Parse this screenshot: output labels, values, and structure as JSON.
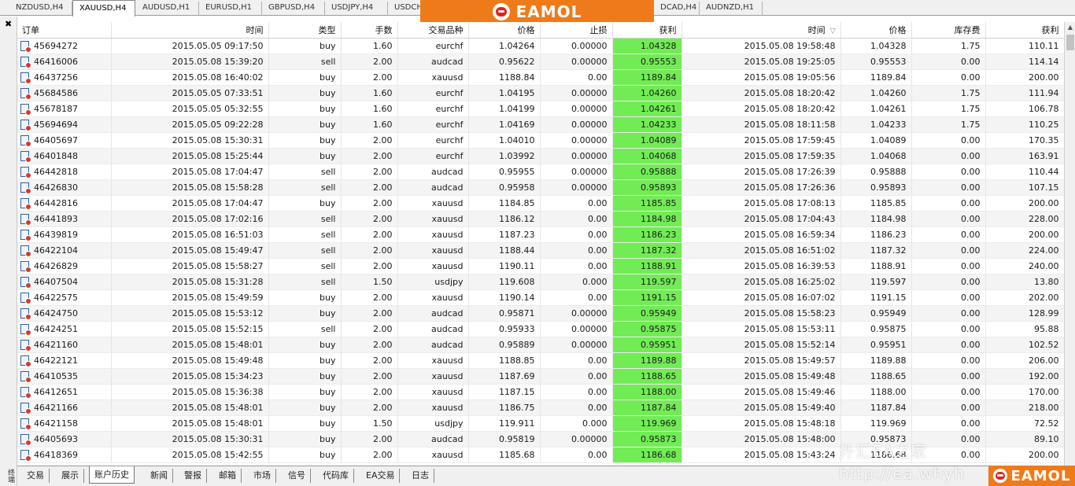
{
  "chart_tabs": [
    {
      "label": "NZDUSD,H4",
      "active": false
    },
    {
      "label": "XAUUSD,H4",
      "active": true
    },
    {
      "label": "AUDUSD,H1",
      "active": false
    },
    {
      "label": "EURUSD,H1",
      "active": false
    },
    {
      "label": "GBPUSD,H4",
      "active": false
    },
    {
      "label": "USDJPY,H4",
      "active": false
    },
    {
      "label": "USDCH",
      "active": false
    },
    {
      "label": "DCAD,H4",
      "active": false
    },
    {
      "label": "AUDNZD,H1",
      "active": false
    }
  ],
  "logo": {
    "text": "EAMOL"
  },
  "watermark": {
    "line1": "外汇EA之家",
    "line2": "http://ea.whyh"
  },
  "side_label": "终端",
  "columns": [
    "订单",
    "时间",
    "类型",
    "手数",
    "交易品种",
    "价格",
    "止损",
    "获利",
    "时间",
    "价格",
    "库存费",
    "获利"
  ],
  "sort_indicator": "▽",
  "colors": {
    "profit_highlight": "#71ec55",
    "logo_orange": "#ef7a1a",
    "logo_red": "#e2211c"
  },
  "rows": [
    [
      "45694272",
      "2015.05.05 09:17:50",
      "buy",
      "1.60",
      "eurchf",
      "1.04264",
      "0.00000",
      "1.04328",
      "2015.05.08 19:58:48",
      "1.04328",
      "1.75",
      "110.11"
    ],
    [
      "46416006",
      "2015.05.08 15:39:20",
      "sell",
      "2.00",
      "audcad",
      "0.95622",
      "0.00000",
      "0.95553",
      "2015.05.08 19:25:05",
      "0.95553",
      "0.00",
      "114.14"
    ],
    [
      "46437256",
      "2015.05.08 16:40:02",
      "buy",
      "2.00",
      "xauusd",
      "1188.84",
      "0.00",
      "1189.84",
      "2015.05.08 19:05:56",
      "1189.84",
      "0.00",
      "200.00"
    ],
    [
      "45684586",
      "2015.05.05 07:33:51",
      "buy",
      "1.60",
      "eurchf",
      "1.04195",
      "0.00000",
      "1.04260",
      "2015.05.08 18:20:42",
      "1.04260",
      "1.75",
      "111.94"
    ],
    [
      "45678187",
      "2015.05.05 05:32:55",
      "buy",
      "1.60",
      "eurchf",
      "1.04199",
      "0.00000",
      "1.04261",
      "2015.05.08 18:20:42",
      "1.04261",
      "1.75",
      "106.78"
    ],
    [
      "45694694",
      "2015.05.05 09:22:28",
      "buy",
      "1.60",
      "eurchf",
      "1.04169",
      "0.00000",
      "1.04233",
      "2015.05.08 18:11:58",
      "1.04233",
      "1.75",
      "110.25"
    ],
    [
      "46405697",
      "2015.05.08 15:30:31",
      "buy",
      "2.00",
      "eurchf",
      "1.04010",
      "0.00000",
      "1.04089",
      "2015.05.08 17:59:45",
      "1.04089",
      "0.00",
      "170.35"
    ],
    [
      "46401848",
      "2015.05.08 15:25:44",
      "buy",
      "2.00",
      "eurchf",
      "1.03992",
      "0.00000",
      "1.04068",
      "2015.05.08 17:59:35",
      "1.04068",
      "0.00",
      "163.91"
    ],
    [
      "46442818",
      "2015.05.08 17:04:47",
      "sell",
      "2.00",
      "audcad",
      "0.95955",
      "0.00000",
      "0.95888",
      "2015.05.08 17:26:39",
      "0.95888",
      "0.00",
      "110.44"
    ],
    [
      "46426830",
      "2015.05.08 15:58:28",
      "sell",
      "2.00",
      "audcad",
      "0.95958",
      "0.00000",
      "0.95893",
      "2015.05.08 17:26:36",
      "0.95893",
      "0.00",
      "107.15"
    ],
    [
      "46442816",
      "2015.05.08 17:04:47",
      "buy",
      "2.00",
      "xauusd",
      "1184.85",
      "0.00",
      "1185.85",
      "2015.05.08 17:08:13",
      "1185.85",
      "0.00",
      "200.00"
    ],
    [
      "46441893",
      "2015.05.08 17:02:16",
      "sell",
      "2.00",
      "xauusd",
      "1186.12",
      "0.00",
      "1184.98",
      "2015.05.08 17:04:43",
      "1184.98",
      "0.00",
      "228.00"
    ],
    [
      "46439819",
      "2015.05.08 16:51:03",
      "sell",
      "2.00",
      "xauusd",
      "1187.23",
      "0.00",
      "1186.23",
      "2015.05.08 16:59:34",
      "1186.23",
      "0.00",
      "200.00"
    ],
    [
      "46422104",
      "2015.05.08 15:49:47",
      "sell",
      "2.00",
      "xauusd",
      "1188.44",
      "0.00",
      "1187.32",
      "2015.05.08 16:51:02",
      "1187.32",
      "0.00",
      "224.00"
    ],
    [
      "46426829",
      "2015.05.08 15:58:27",
      "sell",
      "2.00",
      "xauusd",
      "1190.11",
      "0.00",
      "1188.91",
      "2015.05.08 16:39:53",
      "1188.91",
      "0.00",
      "240.00"
    ],
    [
      "46407504",
      "2015.05.08 15:31:28",
      "sell",
      "1.50",
      "usdjpy",
      "119.608",
      "0.000",
      "119.597",
      "2015.05.08 16:25:02",
      "119.597",
      "0.00",
      "13.80"
    ],
    [
      "46422575",
      "2015.05.08 15:49:59",
      "buy",
      "2.00",
      "xauusd",
      "1190.14",
      "0.00",
      "1191.15",
      "2015.05.08 16:07:02",
      "1191.15",
      "0.00",
      "202.00"
    ],
    [
      "46424750",
      "2015.05.08 15:53:12",
      "buy",
      "2.00",
      "audcad",
      "0.95871",
      "0.00000",
      "0.95949",
      "2015.05.08 15:58:23",
      "0.95949",
      "0.00",
      "128.99"
    ],
    [
      "46424251",
      "2015.05.08 15:52:15",
      "sell",
      "2.00",
      "audcad",
      "0.95933",
      "0.00000",
      "0.95875",
      "2015.05.08 15:53:11",
      "0.95875",
      "0.00",
      "95.88"
    ],
    [
      "46421160",
      "2015.05.08 15:48:01",
      "buy",
      "2.00",
      "audcad",
      "0.95889",
      "0.00000",
      "0.95951",
      "2015.05.08 15:52:14",
      "0.95951",
      "0.00",
      "102.52"
    ],
    [
      "46422121",
      "2015.05.08 15:49:48",
      "buy",
      "2.00",
      "xauusd",
      "1188.85",
      "0.00",
      "1189.88",
      "2015.05.08 15:49:57",
      "1189.88",
      "0.00",
      "206.00"
    ],
    [
      "46410535",
      "2015.05.08 15:34:23",
      "buy",
      "2.00",
      "xauusd",
      "1187.69",
      "0.00",
      "1188.65",
      "2015.05.08 15:49:48",
      "1188.65",
      "0.00",
      "192.00"
    ],
    [
      "46412651",
      "2015.05.08 15:36:38",
      "buy",
      "2.00",
      "xauusd",
      "1187.15",
      "0.00",
      "1188.00",
      "2015.05.08 15:49:46",
      "1188.00",
      "0.00",
      "170.00"
    ],
    [
      "46421166",
      "2015.05.08 15:48:01",
      "buy",
      "2.00",
      "xauusd",
      "1186.75",
      "0.00",
      "1187.84",
      "2015.05.08 15:49:40",
      "1187.84",
      "0.00",
      "218.00"
    ],
    [
      "46421158",
      "2015.05.08 15:48:01",
      "buy",
      "1.50",
      "usdjpy",
      "119.911",
      "0.000",
      "119.969",
      "2015.05.08 15:48:18",
      "119.969",
      "0.00",
      "72.52"
    ],
    [
      "46405693",
      "2015.05.08 15:30:31",
      "buy",
      "2.00",
      "audcad",
      "0.95819",
      "0.00000",
      "0.95873",
      "2015.05.08 15:48:00",
      "0.95873",
      "0.00",
      "89.10"
    ],
    [
      "46418369",
      "2015.05.08 15:42:55",
      "buy",
      "2.00",
      "xauusd",
      "1185.68",
      "0.00",
      "1186.68",
      "2015.05.08 15:43:24",
      "1186.68",
      "0.00",
      "200.00"
    ]
  ],
  "bottom_tabs": [
    {
      "label": "交易",
      "active": false
    },
    {
      "label": "展示",
      "active": false
    },
    {
      "label": "账户历史",
      "active": true
    },
    {
      "label": "新闻",
      "active": false
    },
    {
      "label": "警报",
      "active": false
    },
    {
      "label": "邮箱",
      "active": false
    },
    {
      "label": "市场",
      "active": false
    },
    {
      "label": "信号",
      "active": false
    },
    {
      "label": "代码库",
      "active": false
    },
    {
      "label": "EA交易",
      "active": false
    },
    {
      "label": "日志",
      "active": false
    }
  ]
}
